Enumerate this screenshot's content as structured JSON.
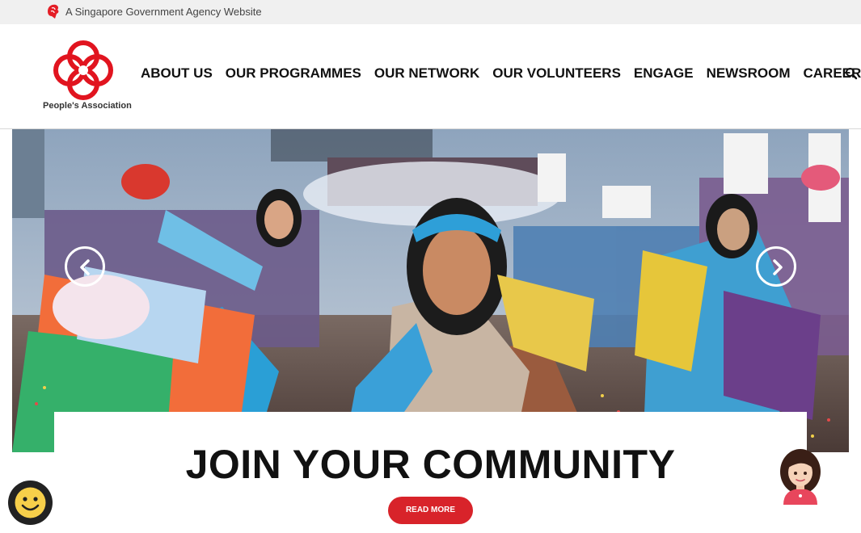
{
  "gov_bar": {
    "text": "A Singapore Government Agency Website",
    "icon": "lion-head-icon"
  },
  "logo": {
    "text": "People's Association"
  },
  "nav": {
    "items": [
      "ABOUT US",
      "OUR PROGRAMMES",
      "OUR NETWORK",
      "OUR VOLUNTEERS",
      "ENGAGE",
      "NEWSROOM",
      "CAREERS"
    ],
    "search_icon": "search-icon"
  },
  "hero": {
    "headline": "JOIN YOUR COMMUNITY",
    "button": "READ MORE",
    "prev_icon": "chevron-left-icon",
    "next_icon": "chevron-right-icon"
  },
  "widgets": {
    "feedback_icon": "smiley-face-icon",
    "chat_icon": "assistant-avatar-icon"
  },
  "colors": {
    "brand_red": "#d8232a",
    "text_dark": "#111111",
    "gov_bar_bg": "#f0f0f0"
  }
}
